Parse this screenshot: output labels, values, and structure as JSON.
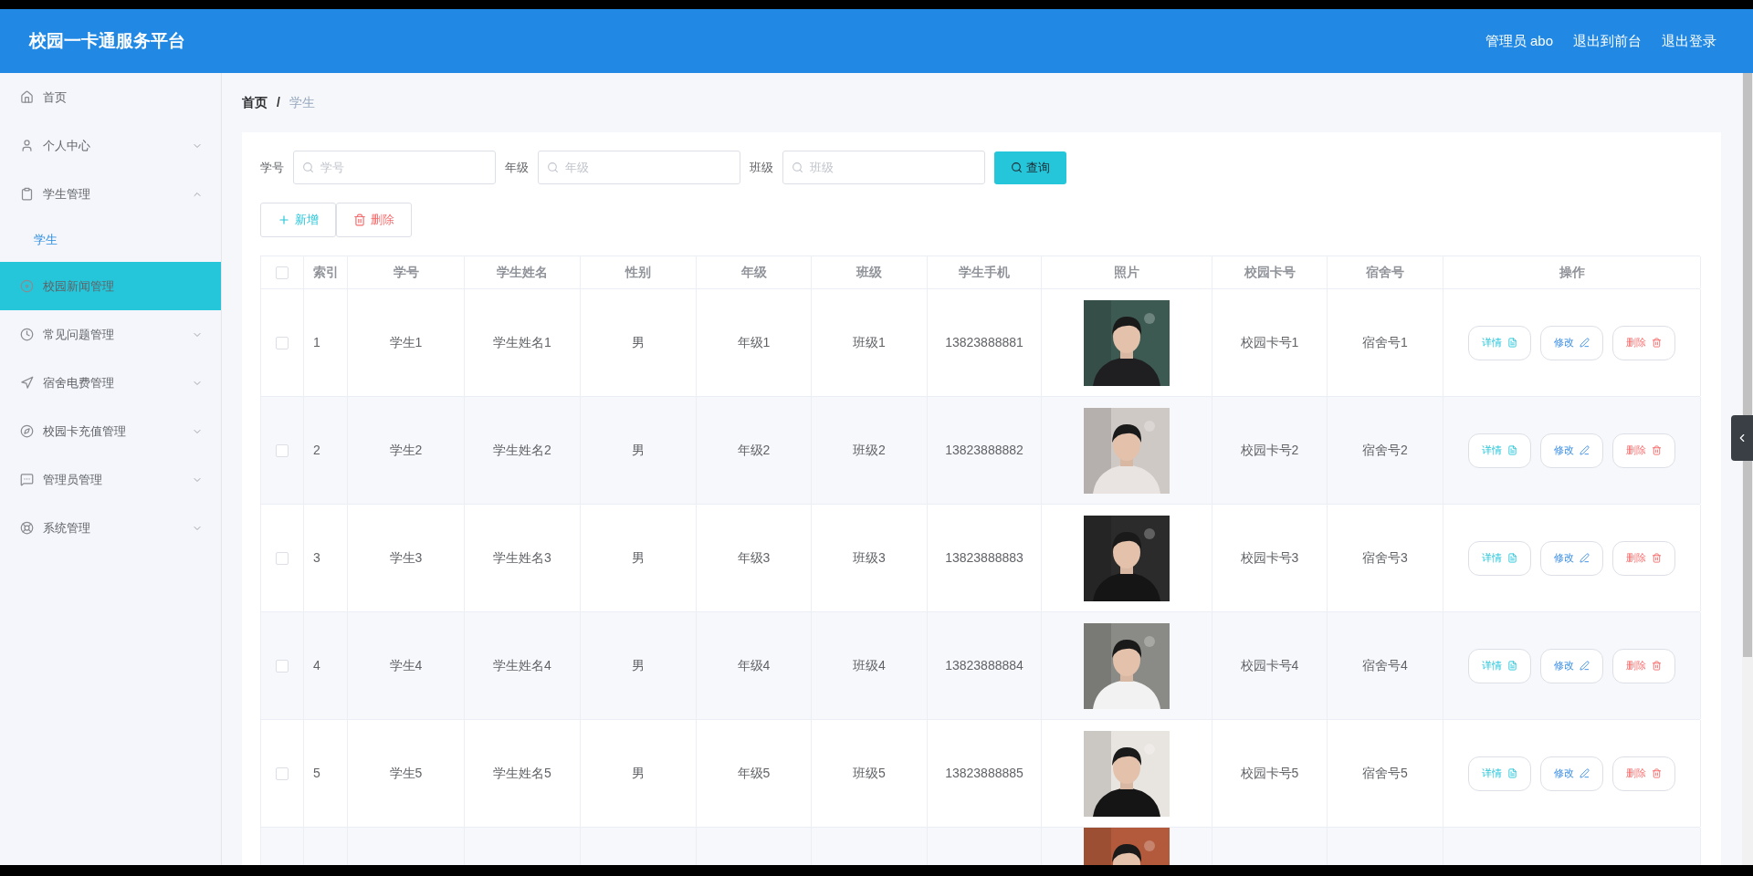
{
  "header": {
    "title": "校园一卡通服务平台",
    "links": [
      "管理员 abo",
      "退出到前台",
      "退出登录"
    ]
  },
  "sidebar": {
    "items": [
      {
        "label": "首页",
        "highlighted": false
      },
      {
        "label": "个人中心",
        "expanded": false,
        "highlighted": false
      },
      {
        "label": "学生管理",
        "expanded": true,
        "highlighted": false,
        "children": [
          {
            "label": "学生",
            "selected": true
          }
        ]
      },
      {
        "label": "校园新闻管理",
        "highlighted": true
      },
      {
        "label": "常见问题管理",
        "expanded": false,
        "highlighted": false
      },
      {
        "label": "宿舍电费管理",
        "expanded": false,
        "highlighted": false
      },
      {
        "label": "校园卡充值管理",
        "expanded": false,
        "highlighted": false
      },
      {
        "label": "管理员管理",
        "expanded": false,
        "highlighted": false
      },
      {
        "label": "系统管理",
        "expanded": false,
        "highlighted": false
      }
    ]
  },
  "breadcrumb": [
    "首页",
    "学生"
  ],
  "breadcrumb_separator": "/",
  "search": {
    "fields": [
      {
        "label": "学号",
        "placeholder": "学号"
      },
      {
        "label": "年级",
        "placeholder": "年级"
      },
      {
        "label": "班级",
        "placeholder": "班级"
      }
    ],
    "button": "查询"
  },
  "toolbar": [
    {
      "label": "新增",
      "kind": "add"
    },
    {
      "label": "删除",
      "kind": "delete"
    }
  ],
  "table": {
    "select_all_checked": false,
    "columns": [
      "索引",
      "学号",
      "学生姓名",
      "性别",
      "年级",
      "班级",
      "学生手机",
      "照片",
      "校园卡号",
      "宿舍号",
      "操作"
    ],
    "rows": [
      {
        "checked": false,
        "cells": [
          "1",
          "学生1",
          "学生姓名1",
          "男",
          "年级1",
          "班级1",
          "13823888881"
        ],
        "photo": {
          "kind": "picture"
        },
        "cells_after": [
          "校园卡号1",
          "宿舍号1"
        ],
        "actions": [
          {
            "label": "详情",
            "kind": "detail"
          },
          {
            "label": "修改",
            "kind": "edit"
          },
          {
            "label": "删除",
            "kind": "delete"
          }
        ]
      },
      {
        "checked": false,
        "cells": [
          "2",
          "学生2",
          "学生姓名2",
          "男",
          "年级2",
          "班级2",
          "13823888882"
        ],
        "photo": {
          "kind": "picture"
        },
        "cells_after": [
          "校园卡号2",
          "宿舍号2"
        ],
        "actions": [
          {
            "label": "详情",
            "kind": "detail"
          },
          {
            "label": "修改",
            "kind": "edit"
          },
          {
            "label": "删除",
            "kind": "delete"
          }
        ]
      },
      {
        "checked": false,
        "cells": [
          "3",
          "学生3",
          "学生姓名3",
          "男",
          "年级3",
          "班级3",
          "13823888883"
        ],
        "photo": {
          "kind": "picture"
        },
        "cells_after": [
          "校园卡号3",
          "宿舍号3"
        ],
        "actions": [
          {
            "label": "详情",
            "kind": "detail"
          },
          {
            "label": "修改",
            "kind": "edit"
          },
          {
            "label": "删除",
            "kind": "delete"
          }
        ]
      },
      {
        "checked": false,
        "cells": [
          "4",
          "学生4",
          "学生姓名4",
          "男",
          "年级4",
          "班级4",
          "13823888884"
        ],
        "photo": {
          "kind": "picture"
        },
        "cells_after": [
          "校园卡号4",
          "宿舍号4"
        ],
        "actions": [
          {
            "label": "详情",
            "kind": "detail"
          },
          {
            "label": "修改",
            "kind": "edit"
          },
          {
            "label": "删除",
            "kind": "delete"
          }
        ]
      },
      {
        "checked": false,
        "cells": [
          "5",
          "学生5",
          "学生姓名5",
          "男",
          "年级5",
          "班级5",
          "13823888885"
        ],
        "photo": {
          "kind": "picture"
        },
        "cells_after": [
          "校园卡号5",
          "宿舍号5"
        ],
        "actions": [
          {
            "label": "详情",
            "kind": "detail"
          },
          {
            "label": "修改",
            "kind": "edit"
          },
          {
            "label": "删除",
            "kind": "delete"
          }
        ]
      }
    ]
  }
}
